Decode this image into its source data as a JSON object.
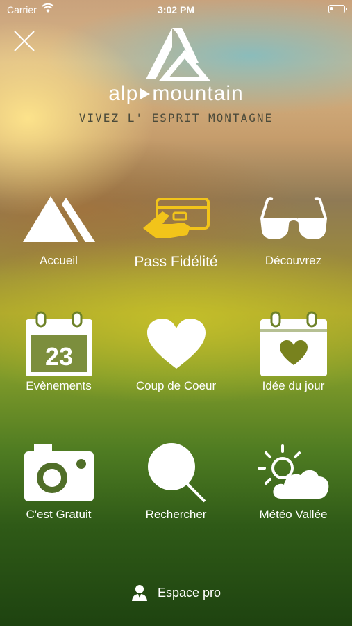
{
  "status_bar": {
    "carrier": "Carrier",
    "time": "3:02 PM"
  },
  "header": {
    "close_icon": "close-icon",
    "brand_left": "alp",
    "brand_right": "mountain",
    "tagline": "VIVEZ L' ESPRIT MONTAGNE"
  },
  "menu": {
    "items": [
      {
        "label": "Accueil",
        "icon": "mountains-icon"
      },
      {
        "label": "Pass Fidélité",
        "icon": "hand-card-icon",
        "accent": "#f2c41a"
      },
      {
        "label": "Découvrez",
        "icon": "glasses-icon"
      },
      {
        "label": "Evènements",
        "icon": "calendar-icon",
        "day": "23"
      },
      {
        "label": "Coup de Coeur",
        "icon": "heart-icon"
      },
      {
        "label": "Idée du jour",
        "icon": "calendar-heart-icon"
      },
      {
        "label": "C'est Gratuit",
        "icon": "camera-icon"
      },
      {
        "label": "Rechercher",
        "icon": "search-icon"
      },
      {
        "label": "Météo Vallée",
        "icon": "weather-icon"
      }
    ]
  },
  "footer": {
    "pro_label": "Espace pro",
    "icon": "user-icon"
  }
}
